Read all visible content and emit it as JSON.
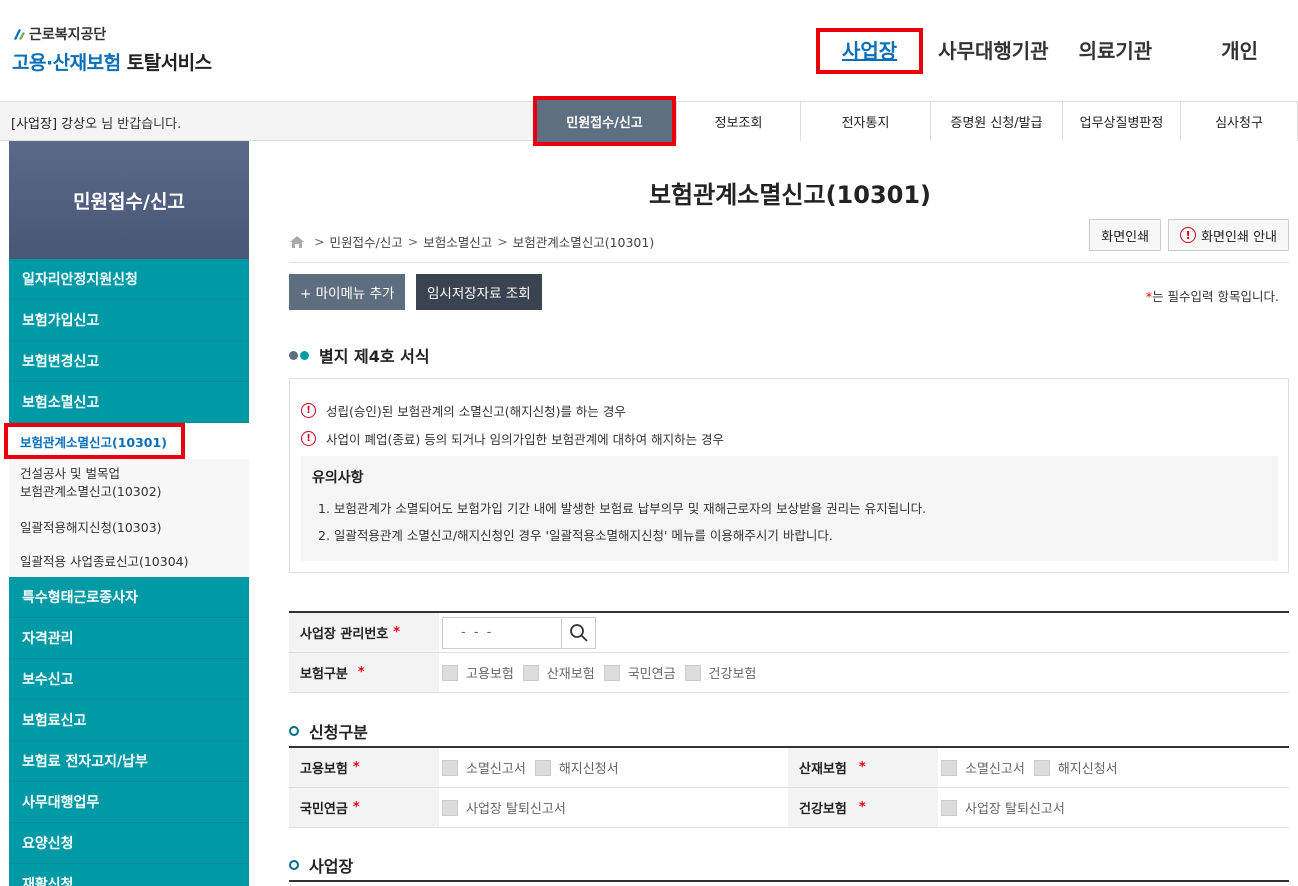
{
  "header": {
    "org_name": "근로복지공단",
    "service_part1": "고용·산재보험",
    "service_part2": "토탈서비스",
    "nav": [
      "사업장",
      "사무대행기관",
      "의료기관",
      "개인"
    ]
  },
  "subbar": {
    "greeting_prefix": "[사업장]",
    "user_name": "강상오",
    "greeting_suffix": "님 반갑습니다.",
    "menu": [
      "민원접수/신고",
      "정보조회",
      "전자통지",
      "증명원 신청/발급",
      "업무상질병판정",
      "심사청구"
    ]
  },
  "sidebar": {
    "title": "민원접수/신고",
    "items_top": [
      "일자리안정지원신청",
      "보험가입신고",
      "보험변경신고",
      "보험소멸신고"
    ],
    "sub_items": [
      "보험관계소멸신고(10301)",
      "건설공사 및 벌목업",
      "보험관계소멸신고(10302)",
      "일괄적용해지신청(10303)",
      "일괄적용 사업종료신고(10304)"
    ],
    "items_bottom": [
      "특수형태근로종사자",
      "자격관리",
      "보수신고",
      "보험료신고",
      "보험료 전자고지/납부",
      "사무대행업무",
      "요양신청",
      "재활신청"
    ]
  },
  "main": {
    "title": "보험관계소멸신고(10301)",
    "breadcrumb": [
      "민원접수/신고",
      "보험소멸신고",
      "보험관계소멸신고(10301)"
    ],
    "print_button": "화면인쇄",
    "print_guide_button": "화면인쇄 안내",
    "mymenu_button": "+ 마이메뉴 추가",
    "temp_button": "임시저장자료 조회",
    "required_star": "*",
    "required_note": "는 필수입력 항목입니다.",
    "form_heading": "별지 제4호 서식",
    "info_lines": [
      "성립(승인)된 보험관계의 소멸신고(해지신청)를 하는 경우",
      "사업이 폐업(종료) 등의 되거나 임의가입한 보험관계에 대하여 해지하는 경우"
    ],
    "notice_title": "유의사항",
    "notice_lines": [
      "1. 보험관계가 소멸되어도 보험가입 기간 내에 발생한 보험료 납부의무 및 재해근로자의 보상받을 권리는 유지됩니다.",
      "2. 일괄적용관계 소멸신고/해지신청인 경우 '일괄적용소멸해지신청' 메뉴를 이용해주시기 바랍니다."
    ],
    "biz_no_label": "사업장 관리번호",
    "biz_no_value": "- -   -",
    "insurance_label": "보험구분",
    "insurance_options": [
      "고용보험",
      "산재보험",
      "국민연금",
      "건강보험"
    ],
    "apply_heading": "신청구분",
    "employment_label": "고용보험",
    "employment_options": [
      "소멸신고서",
      "해지신청서"
    ],
    "industrial_label": "산재보험",
    "industrial_options": [
      "소멸신고서",
      "해지신청서"
    ],
    "pension_label": "국민연금",
    "pension_option": "사업장 탈퇴신고서",
    "health_label": "건강보험",
    "health_option": "사업장 탈퇴신고서",
    "workplace_heading": "사업장"
  },
  "colors": {
    "accent": "#0b6fb8",
    "teal": "#009aa6",
    "highlight": "#e8000b"
  }
}
